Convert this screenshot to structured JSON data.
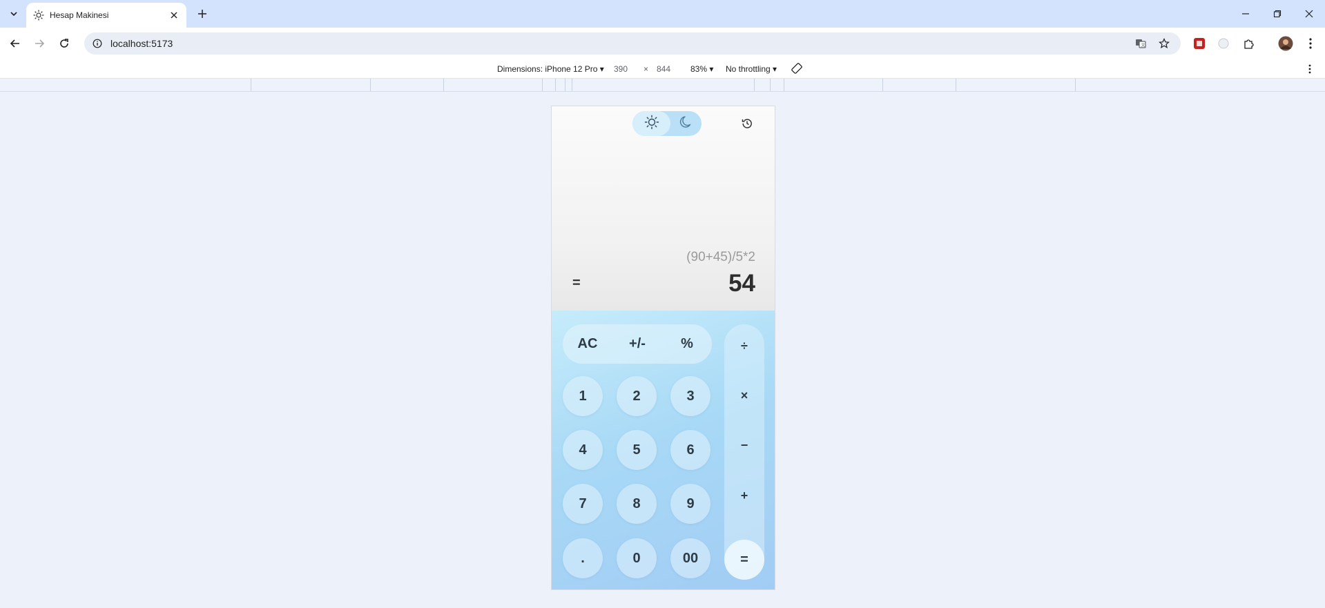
{
  "browser": {
    "tab_title": "Hesap Makinesi",
    "url": "localhost:5173"
  },
  "devtools": {
    "dimensions_label": "Dimensions: iPhone 12 Pro",
    "width": "390",
    "times": "×",
    "height": "844",
    "zoom": "83%",
    "throttling": "No throttling"
  },
  "calculator": {
    "expression": "(90+45)/5*2",
    "equals_sign": "=",
    "result": "54",
    "function_keys": [
      "AC",
      "+/-",
      "%"
    ],
    "digit_keys": [
      "1",
      "2",
      "3",
      "4",
      "5",
      "6",
      "7",
      "8",
      "9",
      ".",
      "0",
      "00"
    ],
    "operator_keys": [
      "÷",
      "×",
      "−",
      "+"
    ],
    "equals_key": "="
  },
  "colors": {
    "accent": "#a8d9f6",
    "toggle": "#b9e0f7"
  }
}
